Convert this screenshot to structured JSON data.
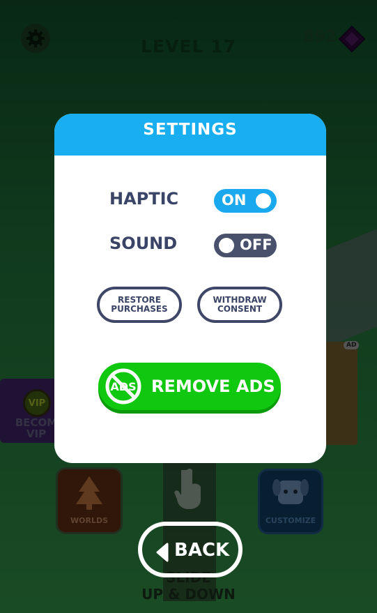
{
  "hud": {
    "level": "LEVEL 17",
    "gems": "892"
  },
  "background": {
    "vip_badge": "VIP",
    "vip_line1": "BECOM",
    "vip_line2": "VIP",
    "ad_tag": "AD",
    "worlds_label": "WORLDS",
    "customize_label": "CUSTOMIZE",
    "slide_line1": "SLIDE",
    "slide_line2": "UP & DOWN"
  },
  "settings": {
    "title": "SETTINGS",
    "haptic": {
      "label": "HAPTIC",
      "state": "ON"
    },
    "sound": {
      "label": "SOUND",
      "state": "OFF"
    },
    "restore_line1": "RESTORE",
    "restore_line2": "PURCHASES",
    "withdraw_line1": "WITHDRAW",
    "withdraw_line2": "CONSENT",
    "remove_ads": "REMOVE ADS",
    "no_ads_icon_text": "ADS"
  },
  "back_label": "BACK",
  "colors": {
    "header_blue": "#19aef0",
    "toggle_on": "#1aa8ef",
    "toggle_off": "#49506b",
    "remove_ads_green": "#10c810",
    "label_navy": "#3a4466"
  }
}
